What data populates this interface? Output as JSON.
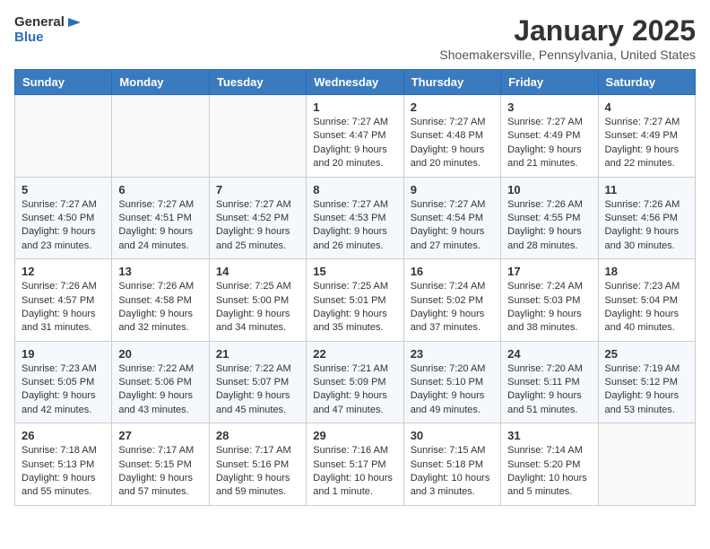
{
  "header": {
    "logo_general": "General",
    "logo_blue": "Blue",
    "month_title": "January 2025",
    "location": "Shoemakersville, Pennsylvania, United States"
  },
  "weekdays": [
    "Sunday",
    "Monday",
    "Tuesday",
    "Wednesday",
    "Thursday",
    "Friday",
    "Saturday"
  ],
  "weeks": [
    [
      {
        "day": "",
        "info": ""
      },
      {
        "day": "",
        "info": ""
      },
      {
        "day": "",
        "info": ""
      },
      {
        "day": "1",
        "info": "Sunrise: 7:27 AM\nSunset: 4:47 PM\nDaylight: 9 hours\nand 20 minutes."
      },
      {
        "day": "2",
        "info": "Sunrise: 7:27 AM\nSunset: 4:48 PM\nDaylight: 9 hours\nand 20 minutes."
      },
      {
        "day": "3",
        "info": "Sunrise: 7:27 AM\nSunset: 4:49 PM\nDaylight: 9 hours\nand 21 minutes."
      },
      {
        "day": "4",
        "info": "Sunrise: 7:27 AM\nSunset: 4:49 PM\nDaylight: 9 hours\nand 22 minutes."
      }
    ],
    [
      {
        "day": "5",
        "info": "Sunrise: 7:27 AM\nSunset: 4:50 PM\nDaylight: 9 hours\nand 23 minutes."
      },
      {
        "day": "6",
        "info": "Sunrise: 7:27 AM\nSunset: 4:51 PM\nDaylight: 9 hours\nand 24 minutes."
      },
      {
        "day": "7",
        "info": "Sunrise: 7:27 AM\nSunset: 4:52 PM\nDaylight: 9 hours\nand 25 minutes."
      },
      {
        "day": "8",
        "info": "Sunrise: 7:27 AM\nSunset: 4:53 PM\nDaylight: 9 hours\nand 26 minutes."
      },
      {
        "day": "9",
        "info": "Sunrise: 7:27 AM\nSunset: 4:54 PM\nDaylight: 9 hours\nand 27 minutes."
      },
      {
        "day": "10",
        "info": "Sunrise: 7:26 AM\nSunset: 4:55 PM\nDaylight: 9 hours\nand 28 minutes."
      },
      {
        "day": "11",
        "info": "Sunrise: 7:26 AM\nSunset: 4:56 PM\nDaylight: 9 hours\nand 30 minutes."
      }
    ],
    [
      {
        "day": "12",
        "info": "Sunrise: 7:26 AM\nSunset: 4:57 PM\nDaylight: 9 hours\nand 31 minutes."
      },
      {
        "day": "13",
        "info": "Sunrise: 7:26 AM\nSunset: 4:58 PM\nDaylight: 9 hours\nand 32 minutes."
      },
      {
        "day": "14",
        "info": "Sunrise: 7:25 AM\nSunset: 5:00 PM\nDaylight: 9 hours\nand 34 minutes."
      },
      {
        "day": "15",
        "info": "Sunrise: 7:25 AM\nSunset: 5:01 PM\nDaylight: 9 hours\nand 35 minutes."
      },
      {
        "day": "16",
        "info": "Sunrise: 7:24 AM\nSunset: 5:02 PM\nDaylight: 9 hours\nand 37 minutes."
      },
      {
        "day": "17",
        "info": "Sunrise: 7:24 AM\nSunset: 5:03 PM\nDaylight: 9 hours\nand 38 minutes."
      },
      {
        "day": "18",
        "info": "Sunrise: 7:23 AM\nSunset: 5:04 PM\nDaylight: 9 hours\nand 40 minutes."
      }
    ],
    [
      {
        "day": "19",
        "info": "Sunrise: 7:23 AM\nSunset: 5:05 PM\nDaylight: 9 hours\nand 42 minutes."
      },
      {
        "day": "20",
        "info": "Sunrise: 7:22 AM\nSunset: 5:06 PM\nDaylight: 9 hours\nand 43 minutes."
      },
      {
        "day": "21",
        "info": "Sunrise: 7:22 AM\nSunset: 5:07 PM\nDaylight: 9 hours\nand 45 minutes."
      },
      {
        "day": "22",
        "info": "Sunrise: 7:21 AM\nSunset: 5:09 PM\nDaylight: 9 hours\nand 47 minutes."
      },
      {
        "day": "23",
        "info": "Sunrise: 7:20 AM\nSunset: 5:10 PM\nDaylight: 9 hours\nand 49 minutes."
      },
      {
        "day": "24",
        "info": "Sunrise: 7:20 AM\nSunset: 5:11 PM\nDaylight: 9 hours\nand 51 minutes."
      },
      {
        "day": "25",
        "info": "Sunrise: 7:19 AM\nSunset: 5:12 PM\nDaylight: 9 hours\nand 53 minutes."
      }
    ],
    [
      {
        "day": "26",
        "info": "Sunrise: 7:18 AM\nSunset: 5:13 PM\nDaylight: 9 hours\nand 55 minutes."
      },
      {
        "day": "27",
        "info": "Sunrise: 7:17 AM\nSunset: 5:15 PM\nDaylight: 9 hours\nand 57 minutes."
      },
      {
        "day": "28",
        "info": "Sunrise: 7:17 AM\nSunset: 5:16 PM\nDaylight: 9 hours\nand 59 minutes."
      },
      {
        "day": "29",
        "info": "Sunrise: 7:16 AM\nSunset: 5:17 PM\nDaylight: 10 hours\nand 1 minute."
      },
      {
        "day": "30",
        "info": "Sunrise: 7:15 AM\nSunset: 5:18 PM\nDaylight: 10 hours\nand 3 minutes."
      },
      {
        "day": "31",
        "info": "Sunrise: 7:14 AM\nSunset: 5:20 PM\nDaylight: 10 hours\nand 5 minutes."
      },
      {
        "day": "",
        "info": ""
      }
    ]
  ]
}
